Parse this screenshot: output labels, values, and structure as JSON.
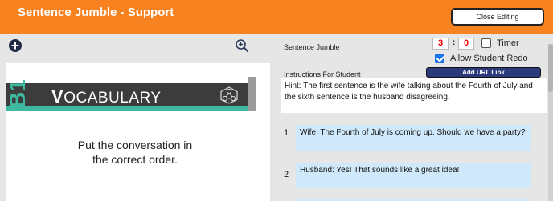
{
  "header": {
    "title": "Sentence Jumble - Support",
    "close_label": "Close Editing"
  },
  "toolbar": {
    "add_icon": "plus-circle-icon",
    "zoom_icon": "zoom-in-icon"
  },
  "preview": {
    "badge": "B1",
    "banner_initial": "V",
    "banner_rest": "OCABULARY",
    "banner_icon": "network-icon",
    "text_line1": "Put the conversation in",
    "text_line2": "the correct order."
  },
  "editor": {
    "activity_label": "Sentence Jumble",
    "time_minutes": "3",
    "time_separator": ":",
    "time_seconds": "0",
    "timer_label": "Timer",
    "timer_checked": false,
    "redo_label": "Allow Student Redo",
    "redo_checked": true,
    "add_url_label": "Add URL Link",
    "instructions_label": "Instructions For Student",
    "instructions_text": "Hint: The first sentence is the wife talking about the Fourth of July and the sixth sentence is the husband disagreeing.",
    "sentences": [
      {
        "num": "1",
        "text": "Wife: The Fourth of July is coming up. Should we have a party?"
      },
      {
        "num": "2",
        "text": "Husband: Yes! That sounds like a great idea!"
      }
    ]
  },
  "colors": {
    "header": "#f7821f",
    "accent_teal": "#3fb8a0",
    "sentence_bg": "#cfe9fb",
    "timer_digits": "#e00000"
  }
}
